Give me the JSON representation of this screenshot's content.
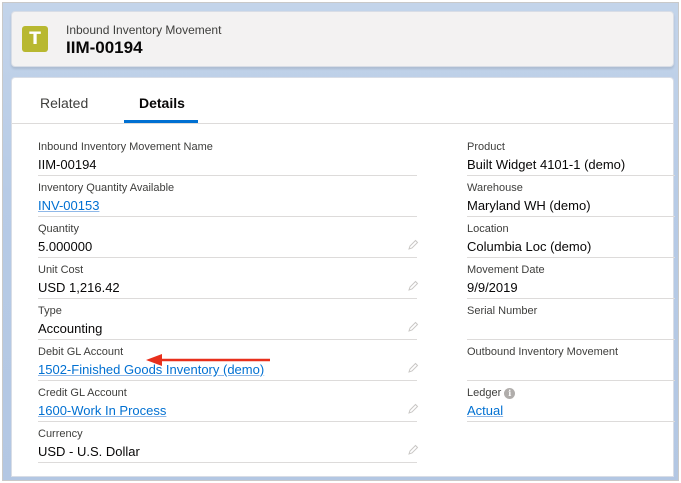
{
  "header": {
    "icon_letter": "T",
    "object_name": "Inbound Inventory Movement",
    "record_name": "IIM-00194"
  },
  "tabs": [
    {
      "label": "Related"
    },
    {
      "label": "Details"
    }
  ],
  "left_fields": [
    {
      "label": "Inbound Inventory Movement Name",
      "value": "IIM-00194"
    },
    {
      "label": "Inventory Quantity Available",
      "value": "INV-00153"
    },
    {
      "label": "Quantity",
      "value": "5.000000"
    },
    {
      "label": "Unit Cost",
      "value": "USD 1,216.42"
    },
    {
      "label": "Type",
      "value": "Accounting"
    },
    {
      "label": "Debit GL Account",
      "value": "1502-Finished Goods Inventory (demo)"
    },
    {
      "label": "Credit GL Account",
      "value": "1600-Work In Process"
    },
    {
      "label": "Currency",
      "value": "USD - U.S. Dollar"
    }
  ],
  "right_fields": [
    {
      "label": "Product",
      "value": "Built Widget 4101-1 (demo)"
    },
    {
      "label": "Warehouse",
      "value": "Maryland WH (demo)"
    },
    {
      "label": "Location",
      "value": "Columbia Loc (demo)"
    },
    {
      "label": "Movement Date",
      "value": "9/9/2019"
    },
    {
      "label": "Serial Number",
      "value": ""
    },
    {
      "label": "Outbound Inventory Movement",
      "value": ""
    },
    {
      "label": "Ledger",
      "value": "Actual"
    }
  ],
  "annotation": {
    "arrow_color": "#e8301c"
  },
  "colors": {
    "link": "#0070d2",
    "tab_active": "#0070d2",
    "icon_bg": "#b8b830"
  }
}
